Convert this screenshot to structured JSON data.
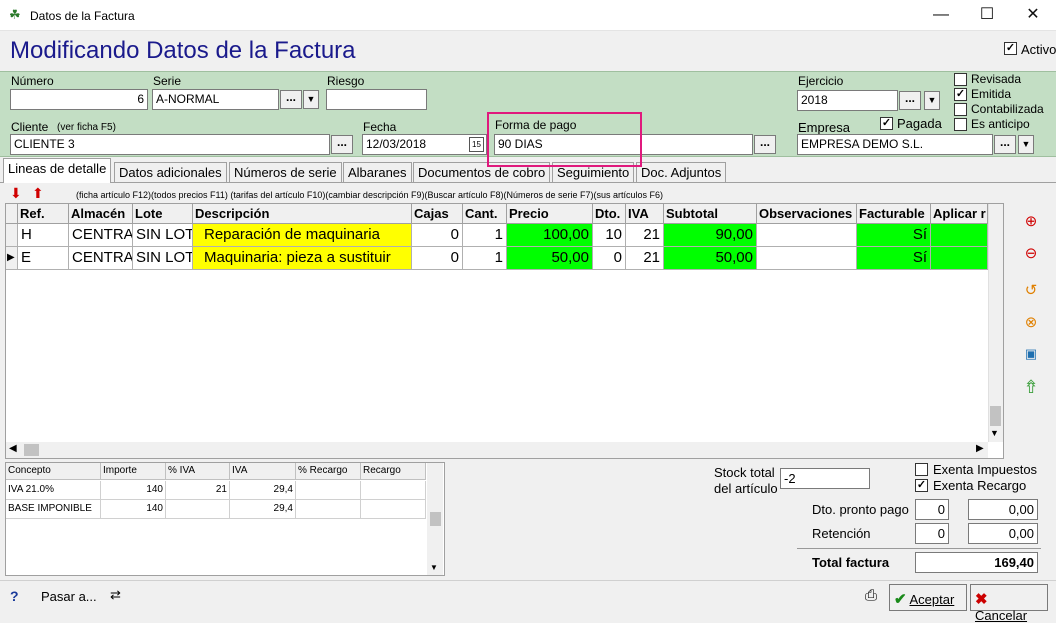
{
  "window": {
    "title": "Datos de la Factura"
  },
  "header": {
    "title": "Modificando Datos de la Factura",
    "activo_label": "Activo",
    "activo_checked": true
  },
  "form": {
    "numero_label": "Número",
    "numero": "6",
    "serie_label": "Serie",
    "serie": "A-NORMAL",
    "riesgo_label": "Riesgo",
    "riesgo": "",
    "ejercicio_label": "Ejercicio",
    "ejercicio": "2018",
    "revisada_label": "Revisada",
    "emitida_label": "Emitida",
    "contabilizada_label": "Contabilizada",
    "es_anticipo_label": "Es anticipo",
    "pagada_label": "Pagada",
    "cliente_label": "Cliente",
    "cliente_hint": "(ver ficha F5)",
    "cliente": "CLIENTE 3",
    "fecha_label": "Fecha",
    "fecha": "12/03/2018",
    "fecha_btn": "15",
    "forma_pago_label": "Forma de pago",
    "forma_pago": "90 DIAS",
    "empresa_label": "Empresa",
    "empresa": "EMPRESA DEMO S.L.",
    "dots": "..."
  },
  "tabs": [
    "Lineas de detalle",
    "Datos adicionales",
    "Números de serie",
    "Albaranes",
    "Documentos de cobro",
    "Seguimiento",
    "Doc. Adjuntos"
  ],
  "shortcuts": "(ficha artículo F12)(todos precios F11)  (tarifas del artículo F10)(cambiar descripción F9)(Buscar artículo F8)(Números de serie F7)(sus artículos F6)",
  "grid": {
    "headers": [
      "Ref.",
      "Almacén",
      "Lote",
      "Descripción",
      "Cajas",
      "Cant.",
      "Precio",
      "Dto.",
      "IVA",
      "Subtotal",
      "Observaciones",
      "Facturable",
      "Aplicar r"
    ],
    "rows": [
      [
        "H",
        "CENTRA",
        "SIN LOT",
        "Reparación de maquinaria",
        "0",
        "1",
        "100,00",
        "10",
        "21",
        "90,00",
        "",
        "Sí",
        ""
      ],
      [
        "E",
        "CENTRA",
        "SIN LOT",
        "Maquinaria: pieza a sustituir",
        "0",
        "1",
        "50,00",
        "0",
        "21",
        "50,00",
        "",
        "Sí",
        ""
      ]
    ]
  },
  "iva": {
    "headers": [
      "Concepto",
      "Importe",
      "% IVA",
      "IVA",
      "% Recargo",
      "Recargo"
    ],
    "rows": [
      [
        "IVA 21.0%",
        "140",
        "21",
        "29,4",
        "",
        ""
      ],
      [
        "BASE IMPONIBLE",
        "140",
        "",
        "29,4",
        "",
        ""
      ]
    ]
  },
  "totals": {
    "stock_label_1": "Stock total",
    "stock_label_2": "del artículo",
    "stock": "-2",
    "exenta_impuestos_label": "Exenta Impuestos",
    "exenta_recargo_label": "Exenta Recargo",
    "dto_pronto_label": "Dto. pronto pago",
    "dto_pronto_pct": "0",
    "dto_pronto_val": "0,00",
    "retencion_label": "Retención",
    "retencion_pct": "0",
    "retencion_val": "0,00",
    "total_label": "Total factura",
    "total": "169,40"
  },
  "footer": {
    "help": "?",
    "pasar": "Pasar a...",
    "aceptar": "Aceptar",
    "cancelar": "Cancelar"
  }
}
